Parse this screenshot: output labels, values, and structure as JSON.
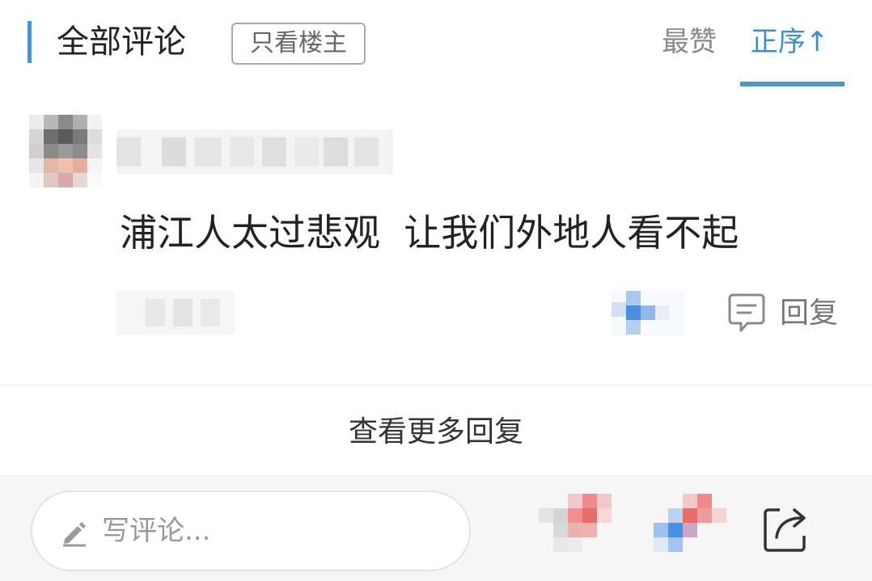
{
  "header": {
    "section_title": "全部评论",
    "op_only_label": "只看楼主",
    "sort_options": [
      "最赞",
      "正序↑"
    ],
    "active_sort": "正序↑"
  },
  "comment": {
    "text": "浦江人太过悲观  让我们外地人看不起",
    "reply_label": "回复"
  },
  "more_replies_label": "查看更多回复",
  "bottom_bar": {
    "input_placeholder": "写评论..."
  },
  "colors": {
    "accent": "#4a96c6",
    "text_primary": "#222222",
    "text_secondary": "#888888",
    "bottom_bar_bg": "#f7f6f6"
  },
  "icons": [
    "reply-bubble-icon",
    "pencil-icon",
    "share-icon"
  ]
}
